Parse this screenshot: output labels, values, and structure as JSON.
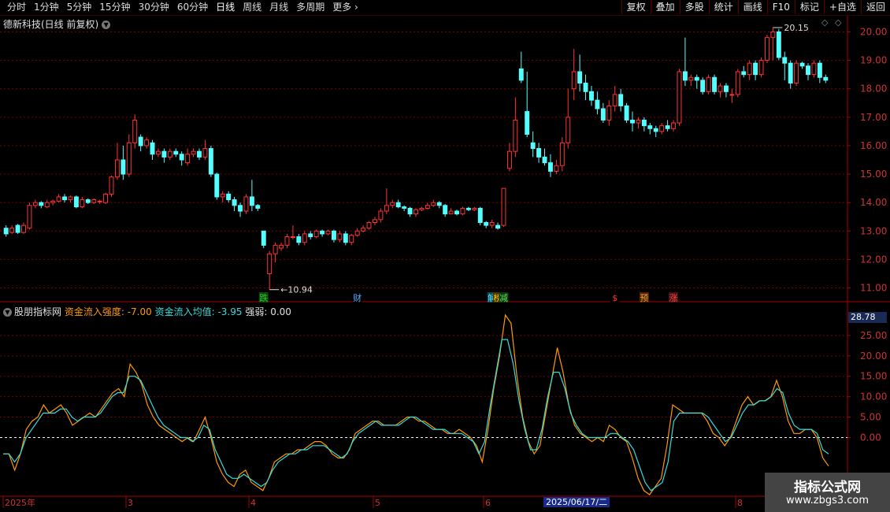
{
  "toolbar": {
    "periods": [
      "分时",
      "1分钟",
      "5分钟",
      "15分钟",
      "30分钟",
      "60分钟",
      "日线",
      "周线",
      "月线",
      "多周期",
      "更多"
    ],
    "active_period": "日线",
    "right_buttons": [
      "复权",
      "叠加",
      "多股",
      "统计",
      "画线",
      "F10",
      "标记",
      "+自选",
      "返回"
    ]
  },
  "stock_title": "德新科技(日线 前复权)",
  "price_axis": [
    "20.00",
    "19.00",
    "18.00",
    "17.00",
    "16.00",
    "15.00",
    "14.00",
    "13.00",
    "12.00",
    "11.00"
  ],
  "annotations": {
    "high": "20.15",
    "low": "10.94"
  },
  "event_markers": [
    {
      "text": "跌",
      "color": "#22cc22",
      "bg": "#114411"
    },
    {
      "text": "财",
      "color": "#55aaff",
      "bg": "#000"
    },
    {
      "text": "解",
      "color": "#55ddff",
      "bg": "#114444"
    },
    {
      "text": "榜",
      "color": "#ffcc00",
      "bg": "#443300"
    },
    {
      "text": "减",
      "color": "#55dd55",
      "bg": "#113311"
    },
    {
      "text": "$",
      "color": "#ff3333",
      "bg": "#000"
    },
    {
      "text": "预",
      "color": "#ff9933",
      "bg": "#442200"
    },
    {
      "text": "涨",
      "color": "#ff4444",
      "bg": "#441111"
    }
  ],
  "indicator": {
    "name": "股朋指标网",
    "line1_label": "资金流入强度: -7.00",
    "line2_label": "资金流入均值: -3.95",
    "line3_label": "强弱: 0.00",
    "current_value": "28.78",
    "axis": [
      "25.00",
      "20.00",
      "15.00",
      "10.00",
      "5.00",
      "0.00"
    ]
  },
  "x_axis": [
    "2025年",
    "3",
    "4",
    "5",
    "6",
    "8"
  ],
  "cursor_date": "2025/06/17/二",
  "watermark": {
    "line1": "指标公式网",
    "line2": "www.zbgs3.com"
  },
  "colors": {
    "up": "#ff3333",
    "down": "#54ffff",
    "grid": "#7a0000",
    "line1": "#ff9900",
    "line2": "#33dddd"
  },
  "chart_data": [
    {
      "type": "candlestick",
      "title": "德新科技(日线 前复权)",
      "ylim": [
        10.6,
        20.4
      ],
      "candles": [
        [
          13.1,
          12.9,
          13.2,
          12.8
        ],
        [
          12.95,
          13.1,
          13.2,
          12.9
        ],
        [
          13.2,
          12.95,
          13.25,
          12.9
        ],
        [
          12.95,
          13.2,
          13.3,
          12.9
        ],
        [
          13.1,
          13.9,
          14.0,
          13.05
        ],
        [
          13.9,
          14.0,
          14.1,
          13.8
        ],
        [
          14.0,
          13.9,
          14.05,
          13.8
        ],
        [
          13.85,
          14.0,
          14.1,
          13.8
        ],
        [
          14.0,
          14.05,
          14.1,
          13.9
        ],
        [
          14.05,
          14.2,
          14.3,
          14.0
        ],
        [
          14.2,
          14.1,
          14.3,
          14.0
        ],
        [
          14.1,
          14.2,
          14.25,
          14.0
        ],
        [
          14.2,
          13.85,
          14.25,
          13.8
        ],
        [
          13.85,
          14.1,
          14.2,
          13.8
        ],
        [
          14.1,
          14.0,
          14.15,
          13.95
        ],
        [
          14.0,
          14.1,
          14.15,
          13.95
        ],
        [
          14.05,
          14.05,
          14.1,
          13.95
        ],
        [
          14.0,
          14.3,
          14.35,
          13.95
        ],
        [
          14.3,
          14.9,
          14.95,
          14.2
        ],
        [
          14.9,
          15.5,
          16.1,
          14.8
        ],
        [
          15.5,
          15.0,
          16.0,
          14.8
        ],
        [
          15.0,
          16.1,
          16.4,
          14.9
        ],
        [
          16.1,
          16.9,
          17.1,
          15.9
        ],
        [
          16.3,
          16.0,
          16.4,
          15.8
        ],
        [
          16.0,
          16.2,
          16.3,
          15.9
        ],
        [
          16.1,
          15.7,
          16.2,
          15.5
        ],
        [
          15.7,
          15.8,
          15.9,
          15.6
        ],
        [
          15.8,
          15.6,
          15.9,
          15.4
        ],
        [
          15.6,
          15.8,
          15.9,
          15.5
        ],
        [
          15.8,
          15.7,
          15.9,
          15.6
        ],
        [
          15.7,
          15.5,
          15.8,
          15.3
        ],
        [
          15.4,
          15.7,
          15.9,
          15.3
        ],
        [
          15.7,
          15.8,
          15.9,
          15.6
        ],
        [
          15.8,
          15.6,
          15.9,
          15.5
        ],
        [
          15.6,
          15.9,
          16.2,
          15.5
        ],
        [
          15.9,
          15.0,
          16.0,
          14.9
        ],
        [
          15.0,
          14.2,
          15.05,
          14.1
        ],
        [
          14.2,
          14.3,
          14.4,
          14.0
        ],
        [
          14.3,
          14.1,
          14.4,
          14.0
        ],
        [
          14.1,
          13.9,
          14.2,
          13.7
        ],
        [
          13.9,
          13.7,
          14.0,
          13.5
        ],
        [
          13.7,
          14.2,
          14.3,
          13.6
        ],
        [
          14.2,
          13.9,
          14.8,
          13.7
        ],
        [
          13.9,
          13.8,
          13.95,
          13.7
        ],
        [
          13.0,
          12.5,
          13.0,
          12.4
        ],
        [
          11.5,
          12.2,
          12.3,
          10.94
        ],
        [
          12.2,
          12.5,
          12.6,
          11.9
        ],
        [
          12.4,
          12.5,
          12.6,
          12.3
        ],
        [
          12.5,
          12.8,
          12.9,
          12.4
        ],
        [
          12.8,
          12.8,
          13.2,
          12.7
        ],
        [
          12.8,
          12.6,
          12.9,
          12.5
        ],
        [
          12.6,
          12.9,
          13.0,
          12.5
        ],
        [
          12.9,
          12.8,
          13.0,
          12.7
        ],
        [
          12.8,
          13.0,
          13.05,
          12.75
        ],
        [
          13.0,
          12.9,
          13.05,
          12.8
        ],
        [
          12.9,
          13.0,
          13.05,
          12.85
        ],
        [
          13.0,
          12.7,
          13.05,
          12.6
        ],
        [
          12.7,
          12.9,
          13.0,
          12.6
        ],
        [
          12.9,
          12.6,
          13.0,
          12.5
        ],
        [
          12.6,
          12.85,
          12.9,
          12.5
        ],
        [
          12.85,
          13.0,
          13.1,
          12.8
        ],
        [
          13.0,
          13.1,
          13.2,
          12.95
        ],
        [
          13.1,
          13.3,
          13.35,
          13.05
        ],
        [
          13.3,
          13.4,
          13.5,
          13.2
        ],
        [
          13.4,
          13.7,
          13.8,
          13.3
        ],
        [
          13.7,
          13.9,
          14.5,
          13.6
        ],
        [
          13.9,
          14.0,
          14.1,
          13.8
        ],
        [
          14.0,
          13.85,
          14.1,
          13.8
        ],
        [
          13.85,
          13.8,
          13.9,
          13.7
        ],
        [
          13.8,
          13.6,
          13.85,
          13.5
        ],
        [
          13.6,
          13.75,
          13.8,
          13.5
        ],
        [
          13.75,
          13.8,
          13.85,
          13.7
        ],
        [
          13.8,
          13.9,
          14.0,
          13.75
        ],
        [
          13.9,
          14.0,
          14.1,
          13.85
        ],
        [
          14.0,
          13.9,
          14.05,
          13.8
        ],
        [
          13.9,
          13.6,
          13.95,
          13.5
        ],
        [
          13.6,
          13.7,
          13.8,
          13.6
        ],
        [
          13.7,
          13.6,
          13.75,
          13.55
        ],
        [
          13.6,
          13.8,
          13.85,
          13.55
        ],
        [
          13.8,
          13.75,
          13.85,
          13.7
        ],
        [
          13.75,
          13.8,
          13.85,
          13.7
        ],
        [
          13.8,
          13.3,
          13.85,
          13.2
        ],
        [
          13.3,
          13.2,
          13.35,
          13.1
        ],
        [
          13.2,
          13.3,
          13.4,
          13.1
        ],
        [
          13.2,
          13.1,
          13.3,
          13.05
        ],
        [
          13.2,
          14.5,
          14.5,
          13.15
        ],
        [
          15.2,
          15.8,
          16.1,
          15.1
        ],
        [
          15.8,
          16.9,
          17.7,
          15.6
        ],
        [
          18.7,
          18.3,
          19.3,
          18.2
        ],
        [
          17.2,
          16.4,
          18.6,
          16.3
        ],
        [
          16.1,
          15.9,
          16.5,
          15.6
        ],
        [
          15.9,
          15.6,
          16.1,
          15.4
        ],
        [
          15.6,
          15.4,
          15.9,
          15.3
        ],
        [
          15.4,
          15.1,
          15.7,
          14.9
        ],
        [
          15.1,
          15.3,
          15.5,
          15.0
        ],
        [
          15.3,
          16.1,
          16.3,
          15.1
        ],
        [
          16.1,
          17.0,
          18.0,
          15.9
        ],
        [
          18.0,
          18.6,
          19.4,
          17.6
        ],
        [
          18.6,
          18.2,
          19.2,
          17.9
        ],
        [
          18.2,
          17.9,
          18.5,
          17.6
        ],
        [
          17.9,
          17.6,
          18.1,
          17.4
        ],
        [
          17.6,
          17.3,
          17.9,
          17.1
        ],
        [
          17.3,
          16.9,
          17.5,
          16.8
        ],
        [
          16.9,
          17.4,
          17.6,
          16.7
        ],
        [
          17.4,
          17.8,
          18.1,
          17.2
        ],
        [
          17.8,
          17.4,
          18.0,
          17.2
        ],
        [
          17.4,
          16.9,
          17.5,
          16.8
        ],
        [
          16.9,
          16.8,
          17.2,
          16.5
        ],
        [
          16.8,
          16.9,
          17.0,
          16.6
        ],
        [
          16.9,
          16.7,
          17.0,
          16.5
        ],
        [
          16.7,
          16.6,
          16.8,
          16.4
        ],
        [
          16.6,
          16.5,
          16.7,
          16.3
        ],
        [
          16.5,
          16.7,
          16.8,
          16.4
        ],
        [
          16.7,
          16.6,
          16.9,
          16.5
        ],
        [
          16.6,
          16.8,
          16.9,
          16.5
        ],
        [
          16.8,
          18.6,
          18.7,
          16.7
        ],
        [
          18.6,
          18.3,
          19.8,
          18.1
        ],
        [
          18.3,
          18.4,
          18.5,
          18.1
        ],
        [
          18.4,
          18.3,
          18.5,
          18.0
        ],
        [
          18.3,
          17.9,
          18.4,
          17.8
        ],
        [
          17.9,
          18.4,
          18.5,
          17.8
        ],
        [
          18.4,
          17.9,
          18.5,
          17.8
        ],
        [
          17.9,
          18.1,
          18.2,
          17.7
        ],
        [
          18.1,
          17.9,
          18.2,
          17.7
        ],
        [
          17.8,
          17.8,
          18.0,
          17.5
        ],
        [
          17.8,
          18.6,
          18.7,
          17.7
        ],
        [
          18.6,
          18.5,
          18.8,
          18.4
        ],
        [
          18.5,
          18.9,
          19.0,
          18.3
        ],
        [
          18.9,
          18.5,
          19.0,
          18.3
        ],
        [
          18.5,
          19.0,
          19.1,
          18.4
        ],
        [
          19.0,
          19.8,
          19.9,
          18.9
        ],
        [
          19.8,
          20.0,
          20.15,
          19.0
        ],
        [
          20.0,
          19.1,
          20.1,
          19.0
        ],
        [
          19.1,
          18.9,
          19.3,
          18.3
        ],
        [
          18.9,
          18.2,
          19.0,
          18.0
        ],
        [
          18.2,
          18.9,
          19.0,
          18.1
        ],
        [
          18.9,
          18.8,
          18.95,
          18.7
        ],
        [
          18.8,
          18.5,
          18.9,
          18.3
        ],
        [
          18.5,
          18.9,
          19.0,
          18.4
        ],
        [
          18.9,
          18.4,
          19.0,
          18.2
        ],
        [
          18.4,
          18.3,
          18.5,
          18.2
        ]
      ]
    },
    {
      "type": "line",
      "title": "股朋指标网",
      "ylim": [
        -14,
        30
      ],
      "series": [
        {
          "name": "资金流入强度",
          "values": [
            -4,
            -4,
            -8,
            -4,
            2,
            4,
            5,
            8,
            6,
            7,
            8,
            6,
            3,
            4,
            5,
            6,
            5,
            7,
            9,
            11,
            12,
            10,
            18,
            16,
            13,
            8,
            5,
            3,
            2,
            1,
            0,
            -1,
            0,
            -1,
            2,
            5,
            0,
            -6,
            -9,
            -11,
            -12,
            -9,
            -8,
            -11,
            -12,
            -13,
            -10,
            -6,
            -5,
            -4,
            -4,
            -3,
            -3,
            -2,
            -1,
            -1,
            -2,
            -4,
            -5,
            -5,
            -3,
            1,
            2,
            3,
            4,
            4,
            3,
            3,
            3,
            4,
            5,
            5,
            4,
            4,
            3,
            2,
            2,
            1,
            1,
            2,
            1,
            0,
            -2,
            -6,
            2,
            12,
            20,
            30,
            28,
            15,
            5,
            -1,
            -4,
            -2,
            6,
            14,
            22,
            16,
            8,
            3,
            1,
            0,
            -1,
            0,
            -1,
            3,
            2,
            0,
            -1,
            -5,
            -10,
            -13,
            -14,
            -12,
            -10,
            -2,
            8,
            7,
            6,
            6,
            6,
            6,
            4,
            1,
            0,
            -2,
            0,
            4,
            8,
            10,
            8,
            9,
            9,
            10,
            14,
            10,
            4,
            1,
            1,
            2,
            2,
            0,
            -5,
            -7
          ]
        },
        {
          "name": "资金流入均值",
          "values": [
            -4,
            -4,
            -6,
            -4,
            0,
            2,
            4,
            6,
            6,
            6,
            7,
            7,
            5,
            4,
            5,
            5,
            5,
            6,
            8,
            10,
            11,
            11,
            15,
            15,
            14,
            11,
            8,
            5,
            3,
            2,
            1,
            0,
            0,
            -1,
            0,
            3,
            2,
            -3,
            -6,
            -9,
            -10,
            -10,
            -9,
            -10,
            -11,
            -12,
            -11,
            -8,
            -6,
            -5,
            -4,
            -4,
            -3,
            -3,
            -2,
            -2,
            -2,
            -3,
            -4,
            -5,
            -4,
            -1,
            1,
            2,
            3,
            4,
            3,
            3,
            3,
            3,
            4,
            5,
            5,
            4,
            3,
            2,
            2,
            2,
            1,
            1,
            1,
            0,
            -1,
            -4,
            -1,
            8,
            16,
            24,
            24,
            18,
            9,
            2,
            -3,
            -3,
            2,
            10,
            16,
            16,
            12,
            6,
            3,
            1,
            0,
            0,
            0,
            0,
            1,
            1,
            0,
            -1,
            -3,
            -7,
            -11,
            -13,
            -12,
            -11,
            -6,
            4,
            6,
            6,
            6,
            6,
            6,
            5,
            3,
            1,
            -1,
            0,
            3,
            6,
            8,
            8,
            9,
            9,
            10,
            12,
            11,
            6,
            3,
            2,
            2,
            2,
            1,
            -3,
            -4
          ]
        }
      ]
    }
  ]
}
